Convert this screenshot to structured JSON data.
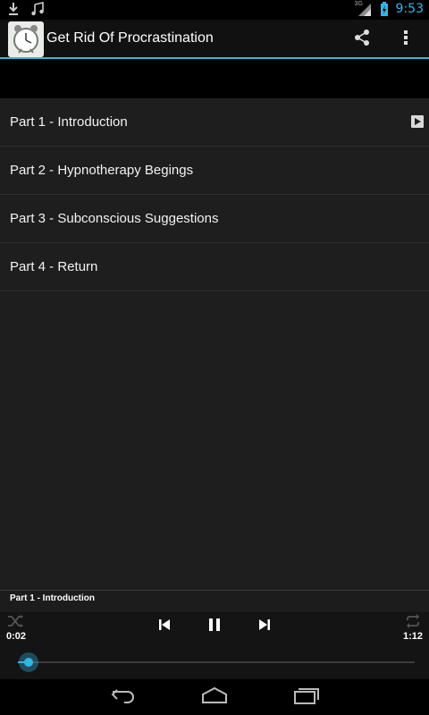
{
  "status_bar": {
    "time": "9:53",
    "network": "3G",
    "icons": [
      "download-icon",
      "music-note-icon",
      "signal-icon",
      "battery-icon"
    ]
  },
  "action_bar": {
    "title": "Get Rid Of Procrastination",
    "icons": [
      "app-clock-icon",
      "share-icon",
      "overflow-menu-icon"
    ]
  },
  "tracks": [
    {
      "label": "Part 1 - Introduction",
      "playing": true
    },
    {
      "label": "Part 2 - Hypnotherapy Begings",
      "playing": false
    },
    {
      "label": "Part 3 - Subconscious Suggestions",
      "playing": false
    },
    {
      "label": "Part 4 - Return",
      "playing": false
    }
  ],
  "player": {
    "now_playing": "Part 1 - Introduction",
    "elapsed": "0:02",
    "duration": "1:12",
    "progress": 0.028,
    "icons": [
      "shuffle-icon",
      "previous-icon",
      "pause-icon",
      "next-icon",
      "repeat-icon"
    ]
  },
  "nav_bar": {
    "icons": [
      "back-icon",
      "home-icon",
      "recent-apps-icon"
    ]
  },
  "colors": {
    "accent": "#33b5e5",
    "list_bg": "#1e1e1e",
    "background": "#000000"
  }
}
